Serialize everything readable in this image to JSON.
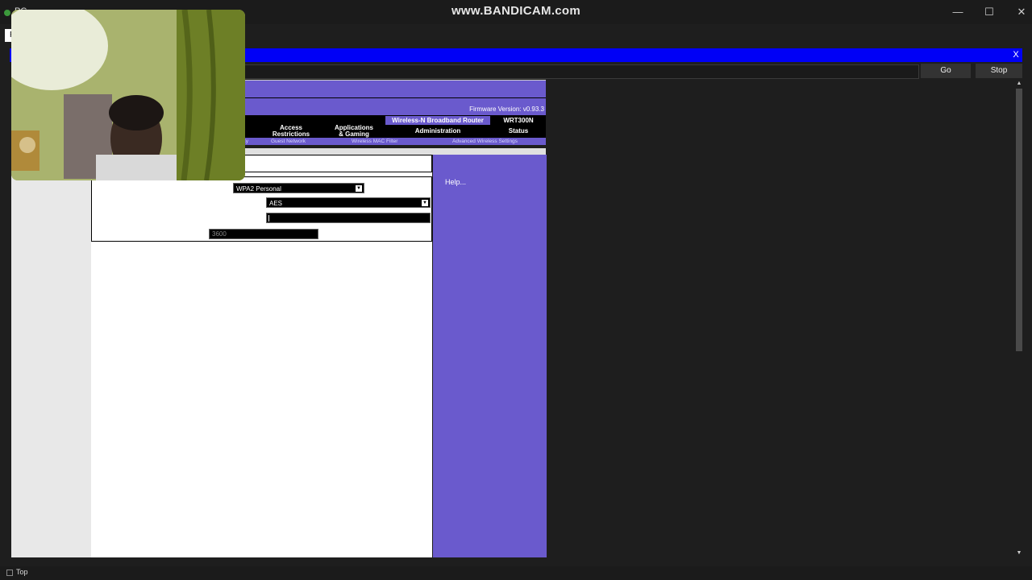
{
  "window": {
    "app_title": "PC",
    "watermark": "www.BANDICAM.com",
    "minimize": "—",
    "maximize": "☐",
    "close": "✕"
  },
  "tabs": {
    "active_tab_label": "P"
  },
  "bluebar": {
    "close_label": "X"
  },
  "browser": {
    "go_label": "Go",
    "stop_label": "Stop"
  },
  "router": {
    "firmware": "Firmware Version: v0.93.3",
    "product_name": "Wireless-N Broadband Router",
    "model": "WRT300N",
    "menu": [
      {
        "line1": "Access",
        "line2": "Restrictions"
      },
      {
        "line1": "Applications",
        "line2": "& Gaming"
      },
      {
        "line1": "Administration",
        "line2": ""
      },
      {
        "line1": "Status",
        "line2": ""
      }
    ],
    "submenu": [
      "Guest Network",
      "Wireless MAC Filter",
      "Advanced Wireless Settings"
    ],
    "submenu_partial": "ty",
    "help_link": "Help..."
  },
  "form": {
    "security_mode": "WPA2 Personal",
    "encryption": "AES",
    "passphrase": "",
    "key_renewal": "3600"
  },
  "statusbar": {
    "label": "Top"
  },
  "colors": {
    "router_purple": "#6a5acd",
    "title_blue": "#0000f6"
  }
}
